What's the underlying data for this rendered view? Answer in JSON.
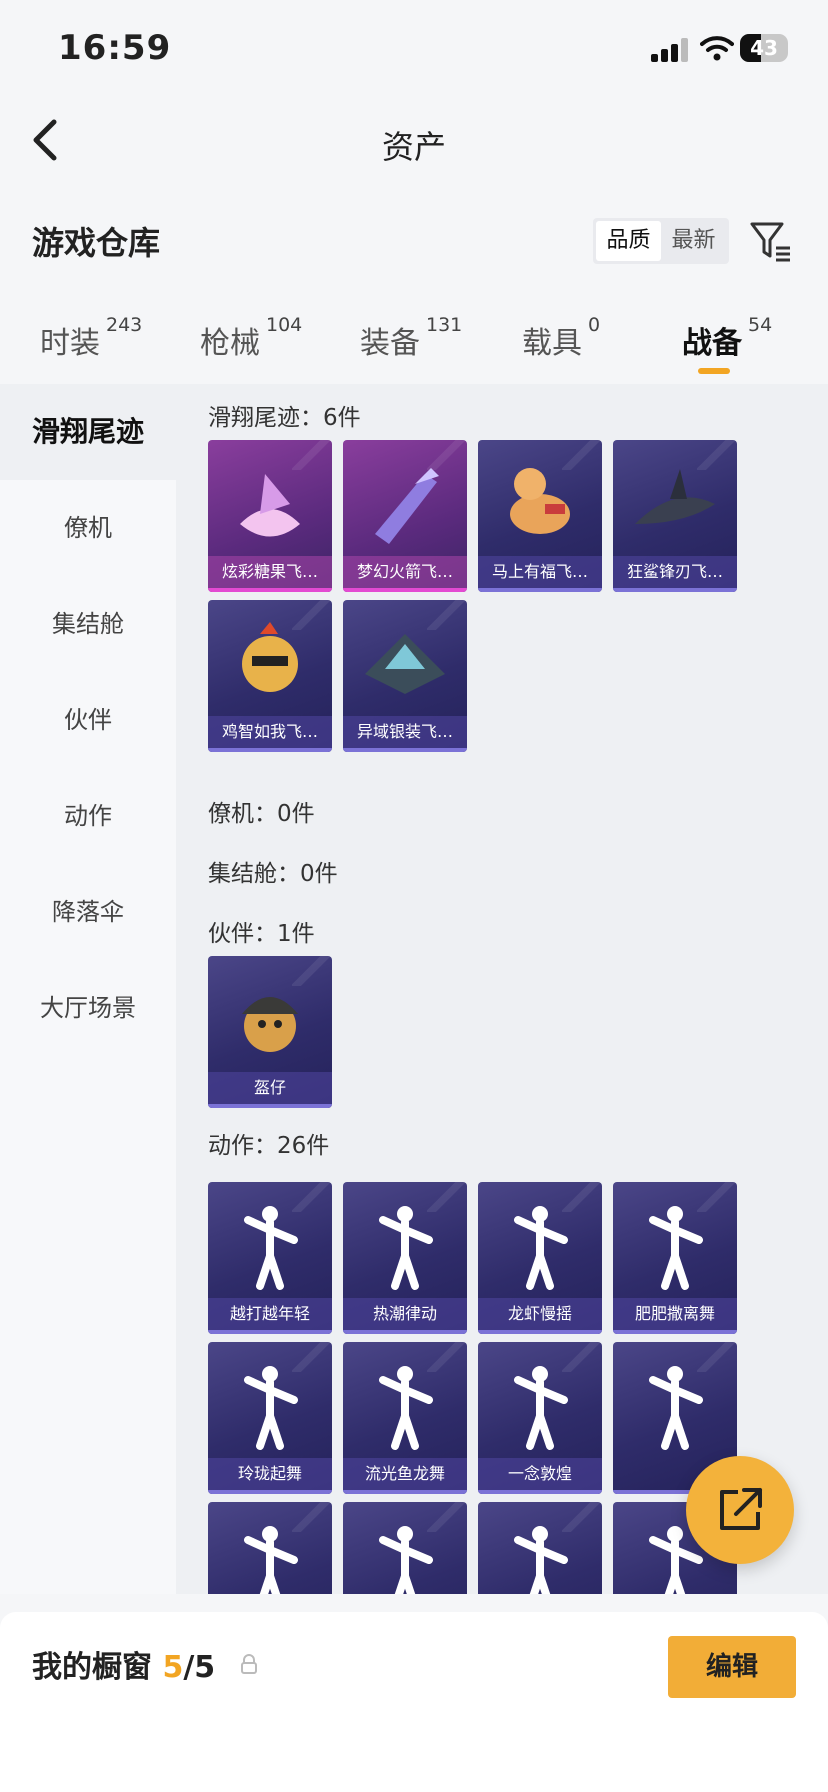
{
  "status_bar": {
    "time": "16:59",
    "battery": "43",
    "battery_level": 0.43
  },
  "nav": {
    "title": "资产"
  },
  "warehouse": {
    "title": "游戏仓库",
    "sort_options": [
      "品质",
      "最新"
    ],
    "selected_sort": "品质"
  },
  "tabs": [
    {
      "label": "时装",
      "count": "243"
    },
    {
      "label": "枪械",
      "count": "104"
    },
    {
      "label": "装备",
      "count": "131"
    },
    {
      "label": "载具",
      "count": "0"
    },
    {
      "label": "战备",
      "count": "54",
      "active": true
    }
  ],
  "sidebar": [
    {
      "label": "滑翔尾迹",
      "active": true
    },
    {
      "label": "僚机"
    },
    {
      "label": "集结舱"
    },
    {
      "label": "伙伴"
    },
    {
      "label": "动作"
    },
    {
      "label": "降落伞"
    },
    {
      "label": "大厅场景"
    }
  ],
  "sections": [
    {
      "header": "滑翔尾迹：6件",
      "items": [
        {
          "name": "炫彩糖果飞…",
          "quality": "pink"
        },
        {
          "name": "梦幻火箭飞…",
          "quality": "pink"
        },
        {
          "name": "马上有福飞…",
          "quality": "purple"
        },
        {
          "name": "狂鲨锋刃飞…",
          "quality": "purple"
        },
        {
          "name": "鸡智如我飞…",
          "quality": "purple"
        },
        {
          "name": "异域银装飞…",
          "quality": "purple"
        }
      ]
    },
    {
      "header": "僚机：0件",
      "items": []
    },
    {
      "header": "集结舱：0件",
      "items": []
    },
    {
      "header": "伙伴：1件",
      "items": [
        {
          "name": "盔仔",
          "quality": "purple"
        }
      ]
    },
    {
      "header": "动作：26件",
      "items": [
        {
          "name": "越打越年轻",
          "quality": "purple"
        },
        {
          "name": "热潮律动",
          "quality": "purple"
        },
        {
          "name": "龙虾慢摇",
          "quality": "purple"
        },
        {
          "name": "肥肥撒离舞",
          "quality": "purple"
        },
        {
          "name": "玲珑起舞",
          "quality": "purple"
        },
        {
          "name": "流光鱼龙舞",
          "quality": "purple"
        },
        {
          "name": "一念敦煌",
          "quality": "purple"
        },
        {
          "name": "",
          "quality": "purple"
        },
        {
          "name": "",
          "quality": "purple"
        },
        {
          "name": "",
          "quality": "purple"
        },
        {
          "name": "",
          "quality": "purple"
        },
        {
          "name": "",
          "quality": "purple"
        }
      ]
    }
  ],
  "showcase": {
    "label": "我的橱窗",
    "current": "5",
    "total": "/5"
  },
  "edit_button": "编辑",
  "colors": {
    "accent": "#f2a523",
    "pink_quality": "#e34ad2",
    "purple_quality": "#7b72d6",
    "fab": "#f3b23b"
  },
  "icons": [
    "back-icon",
    "filter-icon",
    "share-icon",
    "lock-icon",
    "signal-icon",
    "wifi-icon",
    "battery-icon"
  ]
}
